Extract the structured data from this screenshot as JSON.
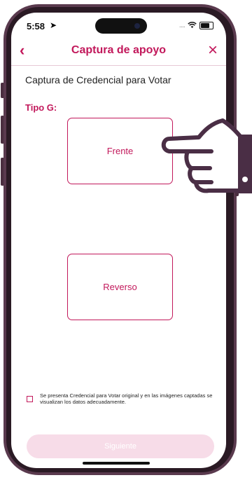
{
  "status_bar": {
    "time": "5:58",
    "signal": "....",
    "wifi": "wifi-icon"
  },
  "nav": {
    "title": "Captura de apoyo",
    "back_icon": "chevron-left-icon",
    "close_icon": "close-icon"
  },
  "content": {
    "heading": "Captura de Credencial para Votar",
    "tipo_label": "Tipo G:",
    "front_label": "Frente",
    "back_label": "Reverso",
    "consent_text": "Se presenta Credencial para Votar original y en las imágenes captadas se visualizan los datos adecuadamente.",
    "next_label": "Siguiente"
  },
  "colors": {
    "accent": "#c2185b",
    "disabled_button": "#f7dce8",
    "frame": "#5a3a4e"
  }
}
